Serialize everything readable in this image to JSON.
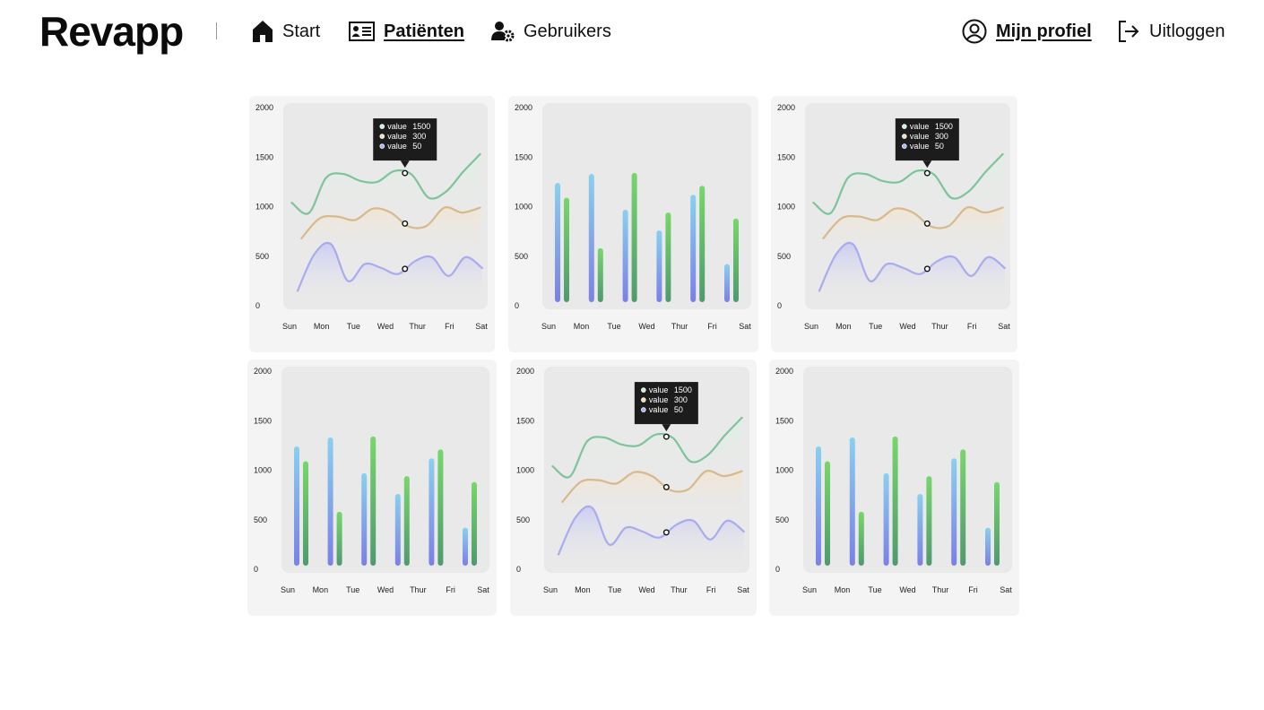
{
  "app": {
    "name": "Revapp"
  },
  "nav": {
    "start": "Start",
    "patients": "Patiënten",
    "users": "Gebruikers",
    "profile": "Mijn profiel",
    "logout": "Uitloggen"
  },
  "colors": {
    "green": "#7ec49a",
    "tan": "#d7b98c",
    "purple": "#a9acec",
    "bar_blue_top": "#8ad0ee",
    "bar_blue_bottom": "#7b7fe6",
    "bar_green_top": "#78d66c",
    "bar_green_bottom": "#4f9a6e",
    "tooltip_bg": "#1c1c1c"
  },
  "chart_data": [
    {
      "type": "line",
      "x": [
        "Sun",
        "Mon",
        "Tue",
        "Wed",
        "Thur",
        "Fri",
        "Sat"
      ],
      "yticks": [
        0,
        500,
        1000,
        1500,
        2000
      ],
      "ylim": [
        0,
        2000
      ],
      "series": [
        {
          "color": "green",
          "values": [
            1040,
            935,
            1290,
            1330,
            1260,
            1250,
            1360,
            1325,
            1090,
            1150,
            1350,
            1530
          ]
        },
        {
          "color": "tan",
          "values": [
            680,
            880,
            900,
            865,
            980,
            940,
            800,
            805,
            990,
            940,
            990
          ]
        },
        {
          "color": "purple",
          "values": [
            150,
            520,
            620,
            250,
            420,
            380,
            320,
            450,
            490,
            300,
            490,
            380
          ]
        }
      ],
      "tooltip": {
        "x": "Wed",
        "rows": [
          {
            "label": "value",
            "value": "1500"
          },
          {
            "label": "value",
            "value": "300"
          },
          {
            "label": "value",
            "value": "50"
          }
        ]
      }
    },
    {
      "type": "bar",
      "categories": [
        "Sun",
        "Mon",
        "Tue",
        "Wed",
        "Thur",
        "Fri",
        "Sat"
      ],
      "yticks": [
        0,
        500,
        1000,
        1500,
        2000
      ],
      "ylim": [
        0,
        2000
      ],
      "series": [
        {
          "color": "blue",
          "values": [
            1240,
            1330,
            970,
            760,
            1120,
            420
          ]
        },
        {
          "color": "green",
          "values": [
            1090,
            580,
            1340,
            940,
            1210,
            880
          ]
        }
      ]
    },
    {
      "type": "line",
      "x": [
        "Sun",
        "Mon",
        "Tue",
        "Wed",
        "Thur",
        "Fri",
        "Sat"
      ],
      "yticks": [
        0,
        500,
        1000,
        1500,
        2000
      ],
      "ylim": [
        0,
        2000
      ],
      "series": [
        {
          "color": "green",
          "values": [
            1040,
            935,
            1290,
            1330,
            1260,
            1250,
            1360,
            1325,
            1090,
            1150,
            1350,
            1530
          ]
        },
        {
          "color": "tan",
          "values": [
            680,
            880,
            900,
            865,
            980,
            940,
            800,
            805,
            990,
            940,
            990
          ]
        },
        {
          "color": "purple",
          "values": [
            150,
            520,
            620,
            250,
            420,
            380,
            320,
            450,
            490,
            300,
            490,
            380
          ]
        }
      ],
      "tooltip": {
        "x": "Wed",
        "rows": [
          {
            "label": "value",
            "value": "1500"
          },
          {
            "label": "value",
            "value": "300"
          },
          {
            "label": "value",
            "value": "50"
          }
        ]
      }
    },
    {
      "type": "bar",
      "categories": [
        "Sun",
        "Mon",
        "Tue",
        "Wed",
        "Thur",
        "Fri",
        "Sat"
      ],
      "yticks": [
        0,
        500,
        1000,
        1500,
        2000
      ],
      "ylim": [
        0,
        2000
      ],
      "series": [
        {
          "color": "blue",
          "values": [
            1240,
            1330,
            970,
            760,
            1120,
            420
          ]
        },
        {
          "color": "green",
          "values": [
            1090,
            580,
            1340,
            940,
            1210,
            880
          ]
        }
      ]
    },
    {
      "type": "line",
      "x": [
        "Sun",
        "Mon",
        "Tue",
        "Wed",
        "Thur",
        "Fri",
        "Sat"
      ],
      "yticks": [
        0,
        500,
        1000,
        1500,
        2000
      ],
      "ylim": [
        0,
        2000
      ],
      "series": [
        {
          "color": "green",
          "values": [
            1040,
            935,
            1290,
            1330,
            1260,
            1250,
            1360,
            1325,
            1090,
            1150,
            1350,
            1530
          ]
        },
        {
          "color": "tan",
          "values": [
            680,
            880,
            900,
            865,
            980,
            940,
            800,
            805,
            990,
            940,
            990
          ]
        },
        {
          "color": "purple",
          "values": [
            150,
            520,
            620,
            250,
            420,
            380,
            320,
            450,
            490,
            300,
            490,
            380
          ]
        }
      ],
      "tooltip": {
        "x": "Wed",
        "rows": [
          {
            "label": "value",
            "value": "1500"
          },
          {
            "label": "value",
            "value": "300"
          },
          {
            "label": "value",
            "value": "50"
          }
        ]
      }
    },
    {
      "type": "bar",
      "categories": [
        "Sun",
        "Mon",
        "Tue",
        "Wed",
        "Thur",
        "Fri",
        "Sat"
      ],
      "yticks": [
        0,
        500,
        1000,
        1500,
        2000
      ],
      "ylim": [
        0,
        2000
      ],
      "series": [
        {
          "color": "blue",
          "values": [
            1240,
            1330,
            970,
            760,
            1120,
            420
          ]
        },
        {
          "color": "green",
          "values": [
            1090,
            580,
            1340,
            940,
            1210,
            880
          ]
        }
      ]
    }
  ]
}
